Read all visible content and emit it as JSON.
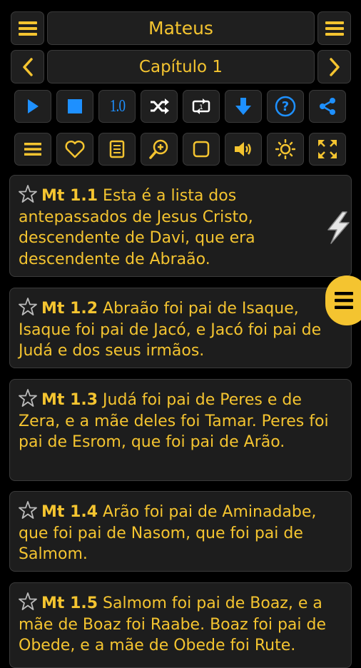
{
  "header": {
    "book_title": "Mateus",
    "chapter_label": "Capítulo 1"
  },
  "toolbar1": {
    "speed_label": "1.0",
    "buttons": [
      "play-icon",
      "stop-icon",
      "speed-button",
      "shuffle-icon",
      "repeat-one-icon",
      "download-icon",
      "help-icon",
      "share-icon"
    ]
  },
  "toolbar2": {
    "buttons": [
      "menu-icon",
      "heart-icon",
      "notes-icon",
      "zoom-in-icon",
      "square-icon",
      "volume-icon",
      "brightness-icon",
      "fullscreen-icon"
    ]
  },
  "verses": [
    {
      "ref": "Mt 1.1",
      "text": "Esta é a lista dos antepassados de Jesus Cristo, descendente de Davi, que era descendente de Abraão."
    },
    {
      "ref": "Mt 1.2",
      "text": "Abraão foi pai de Isaque, Isaque foi pai de Jacó, e Jacó foi pai de Judá e dos seus irmãos."
    },
    {
      "ref": "Mt 1.3",
      "text": "Judá foi pai de Peres e de Zera, e a mãe deles foi Tamar. Peres foi pai de Esrom, que foi pai de Arão."
    },
    {
      "ref": "Mt 1.4",
      "text": "Arão foi pai de Aminadabe, que foi pai de Nasom, que foi pai de Salmom."
    },
    {
      "ref": "Mt 1.5",
      "text": "Salmom foi pai de Boaz, e a mãe de Boaz foi Raabe. Boaz foi pai de Obede, e a mãe de Obede foi Rute."
    }
  ],
  "colors": {
    "accent": "#f4c430",
    "icon_blue": "#1e90ff",
    "background": "#000000",
    "panel": "#1f1f1f"
  }
}
